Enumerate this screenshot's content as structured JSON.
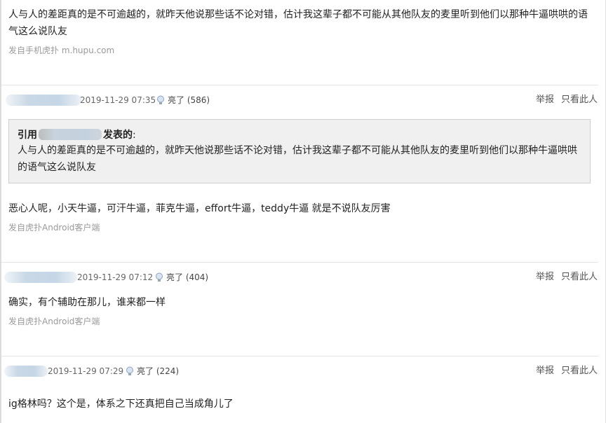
{
  "posts": [
    {
      "body": "人与人的差距真的是不可逾越的，就昨天他说那些话不论对错，估计我这辈子都不可能从其他队友的麦里听到他们以那种牛逼哄哄的语气这么说队友",
      "source": "发自手机虎扑 m.hupu.com"
    },
    {
      "time": "2019-11-29 07:35",
      "light": "亮了 (586)",
      "report": "举报",
      "only_this": "只看此人",
      "quote": {
        "prefix": "引用",
        "suffix": "发表的",
        "colon": ":",
        "body": "人与人的差距真的是不可逾越的，就昨天他说那些话不论对错，估计我这辈子都不可能从其他队友的麦里听到他们以那种牛逼哄哄的语气这么说队友"
      },
      "body": "恶心人呢，小天牛逼，可汗牛逼，菲克牛逼，effort牛逼，teddy牛逼 就是不说队友厉害",
      "source": "发自虎扑Android客户端"
    },
    {
      "time": "2019-11-29 07:12",
      "light": "亮了 (404)",
      "report": "举报",
      "only_this": "只看此人",
      "body": "确实，有个辅助在那儿，谁来都一样",
      "source": "发自虎扑Android客户端"
    },
    {
      "time": "2019-11-29 07:29",
      "light": "亮了 (224)",
      "report": "举报",
      "only_this": "只看此人",
      "body": "ig格林吗？这个是，体系之下还真把自己当成角儿了"
    }
  ],
  "icons": {
    "light": "lightbulb-icon"
  },
  "colors": {
    "quote_bg": "#f0f0f0",
    "source_text": "#9a9a9a",
    "divider": "#e4e4e4"
  }
}
